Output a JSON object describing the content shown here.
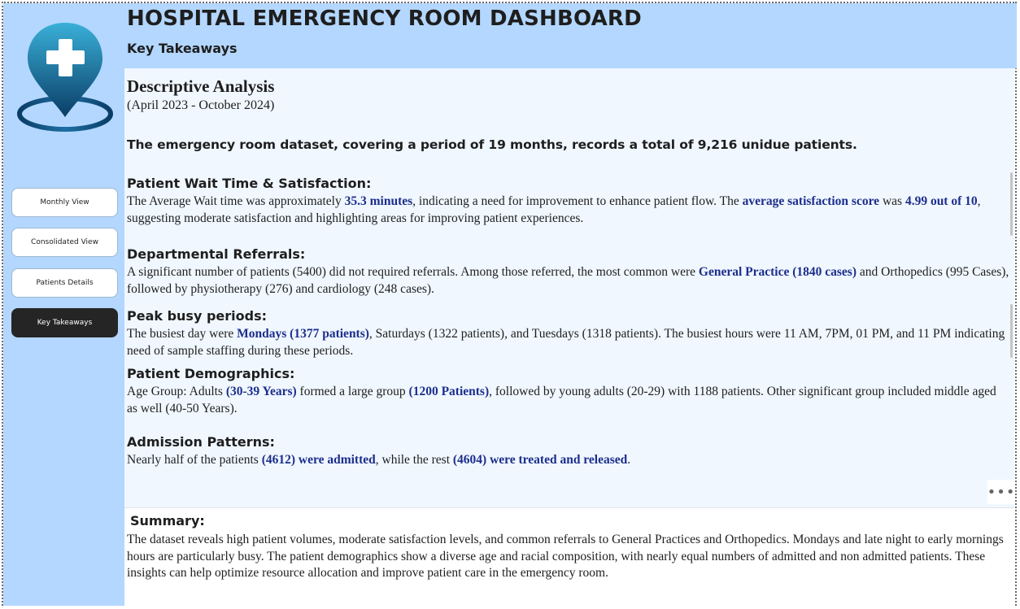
{
  "header": {
    "title": "HOSPITAL EMERGENCY ROOM DASHBOARD",
    "subtitle": "Key Takeaways"
  },
  "nav": [
    {
      "label": "Monthly View",
      "active": false
    },
    {
      "label": "Consolidated View",
      "active": false
    },
    {
      "label": "Patients Details",
      "active": false
    },
    {
      "label": "Key Takeaways",
      "active": true
    }
  ],
  "analysis": {
    "heading": "Descriptive Analysis",
    "period": "(April 2023 - October 2024)",
    "overview": "The emergency room dataset, covering a period of 19 months, records a total of 9,216 unidue patients."
  },
  "wait": {
    "heading": "Patient Wait Time & Satisfaction:",
    "t1": "The Average Wait time was approximately ",
    "h1": "35.3 minutes",
    "t2": ", indicating a need for improvement to enhance patient flow. The ",
    "h2": "average satisfaction score",
    "t3": " was ",
    "h3": "4.99 out of 10",
    "t4": ", suggesting moderate satisfaction and highlighting areas for improving patient experiences."
  },
  "referrals": {
    "heading": "Departmental Referrals:",
    "t1": " A significant number of patients (5400) did not required referrals. Among those referred, the most common were ",
    "h1": "General Practice (1840 cases)",
    "t2": " and Orthopedics (995 Cases), followed by physiotherapy (276) and cardiology (248 cases)."
  },
  "peak": {
    "heading": "Peak busy periods:",
    "t1": "The busiest day were ",
    "h1": "Mondays (1377 patients)",
    "t2": ", Saturdays (1322 patients), and Tuesdays (1318 patients). The busiest hours were 11 AM, 7PM, 01 PM, and 11 PM indicating need of sample staffing during these periods."
  },
  "demographics": {
    "heading": "Patient Demographics:",
    "t1": "Age Group: Adults ",
    "h1": "(30-39 Years)",
    "t2": " formed a large group ",
    "h2": "(1200 Patients)",
    "t3": ", followed by young adults (20-29) with 1188 patients. Other significant group included middle aged as well (40-50 Years)."
  },
  "admission": {
    "heading": "Admission Patterns:",
    "t1": "Nearly half of the patients ",
    "h1": "(4612) were admitted",
    "t2": ", while the rest ",
    "h2": "(4604) were treated and released",
    "t3": "."
  },
  "summary": {
    "heading": "Summary:",
    "text": "The dataset reveals high patient volumes, moderate satisfaction levels, and common referrals to General Practices and Orthopedics. Mondays and late night to early mornings hours are particularly busy. The patient demographics show a diverse age and racial composition, with nearly equal numbers of admitted and non admitted patients. These insights can help optimize resource allocation and improve patient care in the emergency room."
  },
  "colors": {
    "sidebar": "#b3d7ff",
    "header": "#b3d7ff",
    "content": "#f0f7ff",
    "highlight": "#1c2e8c",
    "active_button": "#252525",
    "logo_gradient_top": "#3ab0d8",
    "logo_gradient_bottom": "#0a3d66"
  },
  "icons": {
    "logo": "medical-location-pin-icon",
    "more": "more-options-icon"
  }
}
